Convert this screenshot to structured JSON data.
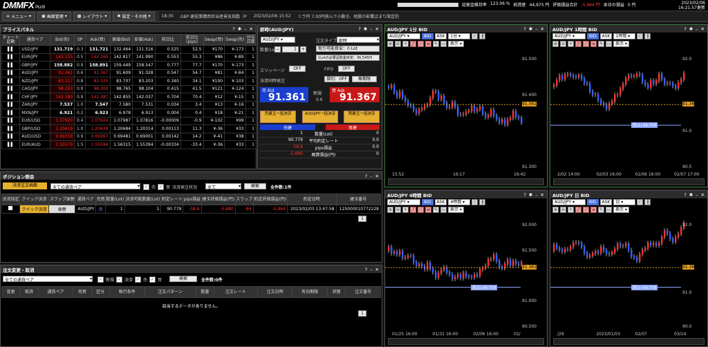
{
  "app": {
    "logo": "DMM",
    "logo_fx": "FX",
    "logo_plus": "PLUS"
  },
  "stats": {
    "l1": "証拠金維持率",
    "v1": "123.06 %",
    "l2": "純資産",
    "v2": "44,975 円",
    "l3": "評価損益合計",
    "v3": "-5,964 円",
    "l4": "本日の損益",
    "v4": "0 円"
  },
  "datetime": {
    "date": "2023/02/06",
    "time": "16:21:57更新"
  },
  "menu": {
    "m1": "メニュー",
    "m2": "画面管理",
    "m3": "レイアウト",
    "m4": "設定・その他"
  },
  "ticker": {
    "time": "18:30",
    "text": "GBP 建設業購買担当者景気指数（P",
    "time2": "2023/02/06 15:52",
    "text2": "リラ円 7.00円挟んで小動き、地震の影響ばまり限定的"
  },
  "price_panel": {
    "title": "プライスパネル",
    "headers": [
      "チャート起動",
      "通貨ペア",
      "Bid(売)",
      "SP",
      "Ask(買)",
      "高値(Bid)",
      "安値(Ask)",
      "前日比",
      "前日比(pips)",
      "Swap(買)",
      "Swap(売)",
      "付与日数"
    ],
    "rows": [
      [
        "USD/JPY",
        "131.719",
        "0.3",
        "131.721",
        "132.464",
        "131.516",
        "0.525",
        "52.5",
        "¥170",
        "¥-173",
        "1",
        "n"
      ],
      [
        "EUR/JPY",
        "142.155",
        "0.5",
        "142.160",
        "142.817",
        "141.990",
        "0.553",
        "55.3",
        "¥86",
        "¥-89",
        "1",
        "r"
      ],
      [
        "GBP/JPY",
        "158.882",
        "0.9",
        "158.891",
        "159.449",
        "158.547",
        "0.777",
        "77.7",
        "¥170",
        "¥-173",
        "1",
        "n"
      ],
      [
        "AUD/JPY",
        "91.361",
        "0.6",
        "91.367",
        "91.609",
        "91.028",
        "0.547",
        "54.7",
        "¥81",
        "¥-84",
        "1",
        "r"
      ],
      [
        "NZD/JPY",
        "83.317",
        "0.8",
        "83.325",
        "83.707",
        "83.203",
        "0.340",
        "34.1",
        "¥100",
        "¥-103",
        "1",
        "r"
      ],
      [
        "CAD/JPY",
        "98.293",
        "0.9",
        "98.300",
        "98.765",
        "98.104",
        "0.415",
        "41.5",
        "¥121",
        "¥-124",
        "1",
        "r"
      ],
      [
        "CHF/JPY",
        "142.380",
        "0.9",
        "142.387",
        "142.855",
        "142.037",
        "0.704",
        "70.4",
        "¥12",
        "¥-15",
        "1",
        "r"
      ],
      [
        "ZAR/JPY",
        "7.537",
        "1.0",
        "7.547",
        "7.580",
        "7.531",
        "0.034",
        "3.4",
        "¥13",
        "¥-16",
        "1",
        "n"
      ],
      [
        "MXN/JPY",
        "6.921",
        "0.2",
        "6.923",
        "6.978",
        "6.913",
        "0.004",
        "0.4",
        "¥18",
        "¥-21",
        "1",
        "n"
      ],
      [
        "EUR/USD",
        "1.07920",
        "0.4",
        "1.07924",
        "1.07987",
        "1.07816",
        "-0.00009",
        "-0.9",
        "¥-102",
        "¥99",
        "1",
        "r"
      ],
      [
        "GBP/USD",
        "1.20619",
        "1.0",
        "1.20629",
        "1.20684",
        "1.20314",
        "0.00113",
        "11.3",
        "¥-36",
        "¥33",
        "1",
        "r"
      ],
      [
        "AUD/USD",
        "0.69358",
        "0.9",
        "0.69367",
        "0.69481",
        "0.69001",
        "0.00142",
        "14.2",
        "¥-41",
        "¥38",
        "1",
        "r"
      ],
      [
        "EUR/AUD",
        "1.55579",
        "1.5",
        "1.55594",
        "1.56315",
        "1.55394",
        "-0.00334",
        "-33.4",
        "¥-36",
        "¥33",
        "1",
        "r"
      ]
    ]
  },
  "order": {
    "title": "即時(AUD/JPY)",
    "pair": "AUD/JPY",
    "type_label": "注文タイプ",
    "type": "即時",
    "qty_label": "数量(Lot)",
    "qty": "1",
    "max1": "取引可能目安：0 Lot",
    "max2": "1Lotの必要証拠金目安：36,545円",
    "slip_label": "スリッページ",
    "slip": "OFF",
    "fifo": "FIFO",
    "fifo_v": "OFF",
    "settle_label": "決済同時発注",
    "settle1": "損切：OFF",
    "settle2": "無期限",
    "bid_label": "売 Bid",
    "bid": "91.361",
    "ask_label": "買 Ask",
    "ask": "91.367",
    "new_label": "新規",
    "sp": "0.6",
    "b1": "売建玉一括決済",
    "b2": "AUD/JPY一括決済",
    "b3": "買建玉一括決済",
    "sell": "売建",
    "buy": "買建",
    "r1": "数量(Lot)",
    "r2": "平均約定レート",
    "r3": "pips損益",
    "r4": "概算損益(円)",
    "sv": [
      "1",
      "90.779",
      "-58.8",
      "-5,880"
    ],
    "bv": [
      "0",
      "0.0",
      "0.0",
      "0"
    ]
  },
  "position": {
    "title": "ポジション照会",
    "btn": "決済注文画面",
    "filter": "全ての通貨ペア",
    "chk1": "売",
    "chk2": "買",
    "status_label": "決済発注状況",
    "status": "全て",
    "search": "検索",
    "count": "全件数:1件",
    "headers": [
      "決済指定",
      "クイック決済",
      "スワップ振替",
      "通貨ペア",
      "売買",
      "数量(Lot)",
      "決済可能数量(Lot)",
      "約定レート",
      "pips損益",
      "建玉評価損益(円)",
      "スワップ",
      "約定評価損益(円)",
      "約定日時",
      "建玉番号"
    ],
    "row": [
      "",
      "クイック決済",
      "振替",
      "AUD/JPY",
      "売",
      "1",
      "1",
      "90.779",
      "-58.8",
      "-5,880",
      "-84",
      "-5,964",
      "2023/02/03 13:47:58",
      "125000010772228"
    ],
    "page": "1"
  },
  "orders": {
    "title": "注文変更・取消",
    "filter": "全ての通貨ペア",
    "c1": "新規",
    "c2": "決済",
    "c3": "売",
    "c4": "買",
    "search": "検索",
    "count": "全件数:0件",
    "headers": [
      "変更",
      "取消",
      "通貨ペア",
      "売買",
      "区分",
      "執行条件",
      "注文パターン",
      "数量",
      "注文レート",
      "注文日時",
      "有効期限",
      "状態",
      "注文番号"
    ],
    "empty": "該当するデータがありません。",
    "page": "1"
  },
  "charts": [
    {
      "title": "AUD/JPY 1分 BID",
      "pair": "AUD/JPY",
      "bid": "BID",
      "ask": "ASK",
      "tf": "1分",
      "disp": "表示",
      "y": [
        "91.500",
        "91.400",
        "91.361",
        "91.300"
      ],
      "x": [
        "15:52",
        "16:17",
        "16:42"
      ]
    },
    {
      "title": "AUD/JPY 1時間 BID",
      "pair": "AUD/JPY",
      "bid": "BID",
      "ask": "ASK",
      "tf": "1時間",
      "disp": "表示",
      "y": [
        "92.0",
        "91.36",
        "91.0",
        "90.5"
      ],
      "x": [
        "2/02 14:00",
        "02/03 16:00",
        "02/06 16:00",
        "02/07 17:00"
      ],
      "pos": "売(1) 90.779"
    },
    {
      "title": "AUD/JPY 4時間 BID",
      "pair": "AUD/JPY",
      "bid": "BID",
      "ask": "ASK",
      "tf": "4時間",
      "disp": "表示",
      "y": [
        "92.000",
        "91.500",
        "91.361",
        "91.000",
        "90.500"
      ],
      "x": [
        "01/25 16:00",
        "01/31 16:00",
        "02/06 16:00",
        "02/"
      ],
      "pos": "売(1) 90.779"
    },
    {
      "title": "AUD/JPY 日 BID",
      "pair": "AUD/JPY",
      "bid": "BID",
      "ask": "ASK",
      "tf": "日",
      "disp": "表示",
      "y": [
        "92.0",
        "91.36",
        "91.0",
        "90.0"
      ],
      "x": [
        "/29",
        "2023/01/03",
        "02/07",
        "03/14"
      ],
      "pos": "売(1) 90.779"
    }
  ]
}
